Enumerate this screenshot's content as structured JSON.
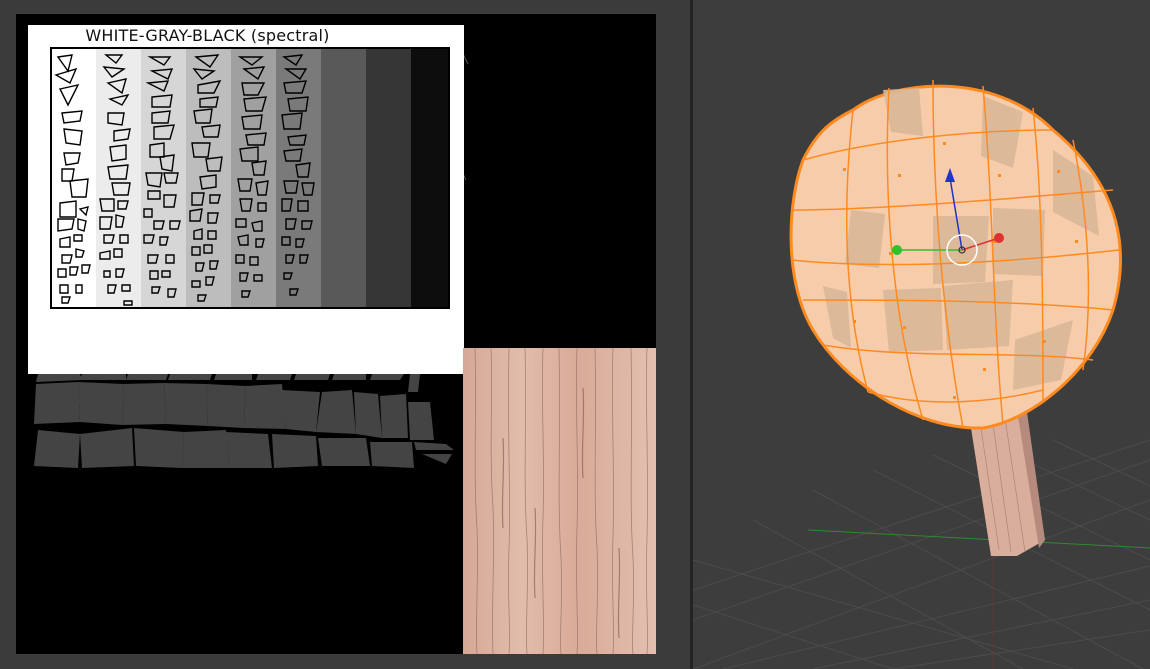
{
  "uv_editor": {
    "test_card": {
      "title": "WHITE-GRAY-BLACK (spectral)",
      "bands": [
        "#ffffff",
        "#e6e6e6",
        "#cccccc",
        "#b3b3b3",
        "#999999",
        "#777777",
        "#555555",
        "#333333",
        "#1a1a1a",
        "#000000"
      ]
    },
    "uv_island_color": "#444444",
    "wood_texture_color": "#d9ad9c"
  },
  "viewport": {
    "mesh_color": "#f5c9a6",
    "selection_color": "#ff8a1f",
    "gizmo": {
      "x_color": "#e0302f",
      "y_color": "#30c030",
      "z_color": "#2233cc"
    },
    "grid_color": "#4a4a4a",
    "axis_colors": {
      "x": "#8a2e2e",
      "y": "#2e8a2e"
    }
  }
}
